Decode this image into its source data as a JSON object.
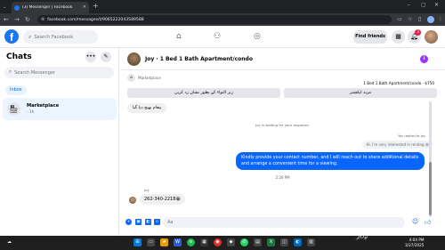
{
  "browser": {
    "tab_title": "(3) Messenger | Facebook",
    "url": "facebook.com/messages/t/9065222043589588"
  },
  "header": {
    "search_placeholder": "Search Facebook",
    "find_friends": "Find friends",
    "notification_count": "3"
  },
  "left": {
    "title": "Chats",
    "search_placeholder": "Search Messenger",
    "inbox_label": "Inbox",
    "conversation": {
      "name": "Marketplace",
      "time": "· 1h"
    }
  },
  "thread": {
    "title": "Joy · 1 Bed 1 Bath Apartment/condo",
    "marketplace_label": "Marketplace",
    "listing": "1 Bed 1 Bath Apartment/condo · $750",
    "quick_reply_1": "زیر التواء کے بطور نشان زد کریں",
    "quick_reply_2": "مزید ایکشنز",
    "incoming_1": "پیغام بھیج دیا گیا",
    "waiting_text": "Joy is waiting for your response.",
    "replied_note": "You replied to Joy",
    "quoted_msg": "Hi, I'm very interested in renting 😀",
    "outgoing": "Kindly provide your contact number, and I will reach out to share additional details and arrange a convenient time for a viewing.",
    "time": "2:26 PM",
    "sender_name": "Joy",
    "phone_msg": "262-340-2218😀",
    "composer_placeholder": "Aa"
  },
  "taskbar": {
    "time": "4:04 PM",
    "date": "3/27/2025"
  },
  "colors": {
    "accent": "#0866ff",
    "brand": "#1877f2"
  }
}
